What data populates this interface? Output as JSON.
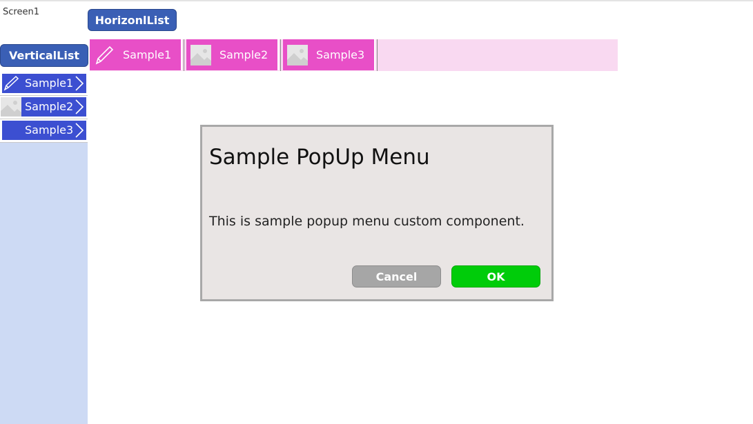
{
  "screen": {
    "name": "Screen1"
  },
  "buttons": {
    "horizontal": "HorizonlList",
    "vertical": "VerticalList"
  },
  "vertical_list": {
    "items": [
      {
        "label": "Sample1",
        "icon": "pencil-icon"
      },
      {
        "label": "Sample2",
        "icon": "image-placeholder-icon"
      },
      {
        "label": "Sample3",
        "icon": ""
      }
    ]
  },
  "horizontal_list": {
    "items": [
      {
        "label": "Sample1",
        "icon": "pencil-icon"
      },
      {
        "label": "Sample2",
        "icon": "image-placeholder-icon"
      },
      {
        "label": "Sample3",
        "icon": "image-placeholder-icon"
      }
    ]
  },
  "popup": {
    "title": "Sample PopUp Menu",
    "message": "This is sample popup menu custom component.",
    "cancel_label": "Cancel",
    "ok_label": "OK"
  },
  "colors": {
    "blue_button": "#3a5fb5",
    "vertical_item": "#3c4fd1",
    "vertical_panel": "#cddaf4",
    "horizontal_item": "#e84fc7",
    "horizontal_panel": "#f9d9f1",
    "ok_button": "#00cc0a",
    "cancel_button": "#a6a6a6",
    "popup_bg": "#e9e5e4"
  }
}
